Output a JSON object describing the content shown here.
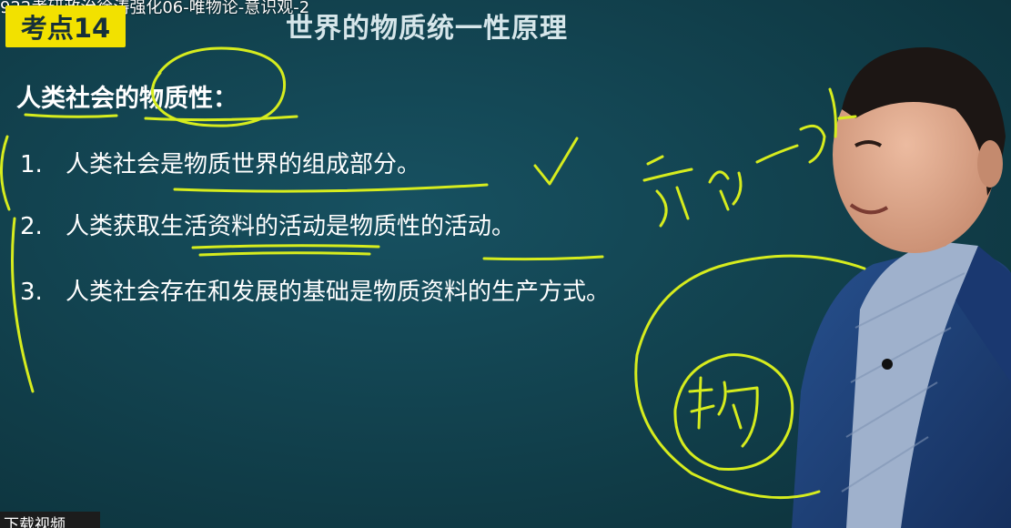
{
  "video": {
    "top_caption": "922考研政治徐涛强化06-唯物论-意识观-2"
  },
  "slide": {
    "badge": "考点14",
    "title": "世界的物质统一性原理",
    "subtitle": "人类社会的物质性：",
    "points": [
      {
        "num": "1.",
        "text": "人类社会是物质世界的组成部分。"
      },
      {
        "num": "2.",
        "text": "人类获取生活资料的活动是物质性的活动。"
      },
      {
        "num": "3.",
        "text": "人类社会存在和发展的基础是物质资料的生产方式。"
      }
    ]
  },
  "colors": {
    "board": "#113f4b",
    "badge": "#f2e100",
    "ink": "#d6ec1e",
    "jacket": "#1f3f78",
    "shirt": "#9fb1cc",
    "skin": "#e0a98c"
  },
  "overlay": {
    "bottom_tag": "下载视频"
  }
}
